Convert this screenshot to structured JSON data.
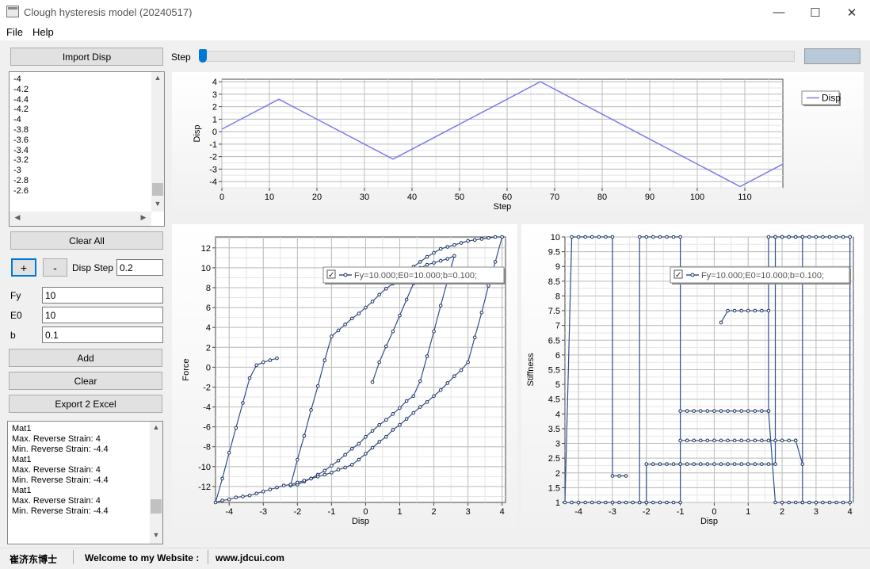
{
  "window": {
    "title": "Clough hysteresis model (20240517)",
    "min": "—",
    "max": "☐",
    "close": "✕"
  },
  "menu": [
    "File",
    "Help"
  ],
  "left": {
    "import_label": "Import Disp",
    "disp_list": [
      "-4",
      "-4.2",
      "-4.4",
      "-4.2",
      "-4",
      "-3.8",
      "-3.6",
      "-3.4",
      "-3.2",
      "-3",
      "-2.8",
      "-2.6"
    ],
    "clear_all_label": "Clear All",
    "plus_label": "+",
    "minus_label": "-",
    "disp_step_label": "Disp Step",
    "disp_step_value": "0.2",
    "fy_label": "Fy",
    "fy_value": "10",
    "e0_label": "E0",
    "e0_value": "10",
    "b_label": "b",
    "b_value": "0.1",
    "add_label": "Add",
    "clear_label": "Clear",
    "export_label": "Export 2 Excel",
    "log_lines": [
      "Mat1",
      "Max. Reverse Strain: 4",
      "Min. Reverse Strain: -4.4",
      "Mat1",
      "Max. Reverse Strain: 4",
      "Min. Reverse Strain: -4.4",
      "Mat1",
      "Max. Reverse Strain: 4",
      "Min. Reverse Strain: -4.4"
    ]
  },
  "step": {
    "label": "Step",
    "position": 0
  },
  "status": {
    "author": "崔济东博士",
    "welcome": "Welcome to my Website :",
    "url": "www.jdcui.com"
  },
  "chart_data": [
    {
      "type": "line",
      "name": "disp-history",
      "xlabel": "Step",
      "ylabel": "Disp",
      "xlim": [
        0,
        118
      ],
      "ylim": [
        -4.5,
        4.2
      ],
      "xticks": [
        0,
        10,
        20,
        30,
        40,
        50,
        60,
        70,
        80,
        90,
        100,
        110
      ],
      "yticks": [
        -4,
        -3,
        -2,
        -1,
        0,
        1,
        2,
        3,
        4
      ],
      "grid": true,
      "legend": "right",
      "series": [
        {
          "name": "Disp",
          "color": "#7b7bea",
          "x": [
            0,
            12,
            36,
            67,
            109,
            118
          ],
          "y": [
            0.2,
            2.6,
            -2.2,
            4,
            -4.4,
            -2.6
          ]
        }
      ]
    },
    {
      "type": "line",
      "name": "force-disp",
      "xlabel": "Disp",
      "ylabel": "Force",
      "xlim": [
        -4.4,
        4.1
      ],
      "ylim": [
        -13.6,
        13.1
      ],
      "xticks": [
        -4,
        -3,
        -2,
        -1,
        0,
        1,
        2,
        3,
        4
      ],
      "yticks": [
        -12,
        -10,
        -8,
        -6,
        -4,
        -2,
        0,
        2,
        4,
        6,
        8,
        10,
        12
      ],
      "grid": true,
      "legend": "top-right",
      "series": [
        {
          "name": "Fy=10.000;E0=10.000;b=0.100;",
          "color": "#2f4f8f",
          "x": [
            0.2,
            0.4,
            0.6,
            0.8,
            1.0,
            1.2,
            1.4,
            1.6,
            1.8,
            2.0,
            2.2,
            2.4,
            2.6,
            2.4,
            2.2,
            2.0,
            1.8,
            1.6,
            1.4,
            1.2,
            1.0,
            0.8,
            0.6,
            0.4,
            0.2,
            0.0,
            -0.2,
            -0.4,
            -0.6,
            -0.8,
            -1.0,
            -1.2,
            -1.4,
            -1.6,
            -1.8,
            -2.0,
            -2.2,
            -2.0,
            -1.8,
            -1.6,
            -1.4,
            -1.2,
            -1.0,
            -0.8,
            -0.6,
            -0.4,
            -0.2,
            0.0,
            0.2,
            0.4,
            0.6,
            0.8,
            1.0,
            1.2,
            1.4,
            1.6,
            1.8,
            2.0,
            2.2,
            2.4,
            2.6,
            2.8,
            3.0,
            3.2,
            3.4,
            3.6,
            3.8,
            4.0,
            3.8,
            3.6,
            3.4,
            3.2,
            3.0,
            2.8,
            2.6,
            2.4,
            2.2,
            2.0,
            1.8,
            1.6,
            1.4,
            1.2,
            1.0,
            0.8,
            0.6,
            0.4,
            0.2,
            0.0,
            -0.2,
            -0.4,
            -0.6,
            -0.8,
            -1.0,
            -1.2,
            -1.4,
            -1.6,
            -1.8,
            -2.0,
            -2.2,
            -2.4,
            -2.6,
            -2.8,
            -3.0,
            -3.2,
            -3.4,
            -3.6,
            -3.8,
            -4.0,
            -4.2,
            -4.4,
            -4.2,
            -4.0,
            -3.8,
            -3.6,
            -3.4,
            -3.2,
            -3.0,
            -2.8,
            -2.6
          ],
          "y": [
            -1.5,
            0.5,
            2.1,
            3.6,
            5.2,
            6.8,
            8.4,
            10.0,
            10.3,
            10.5,
            10.7,
            10.9,
            11.2,
            8.7,
            6.2,
            3.6,
            1.1,
            -1.4,
            -2.9,
            -3.4,
            -4.1,
            -4.7,
            -5.3,
            -5.8,
            -6.4,
            -7.0,
            -7.7,
            -8.2,
            -8.8,
            -9.4,
            -9.9,
            -10.4,
            -10.8,
            -11.2,
            -11.5,
            -11.8,
            -11.9,
            -9.3,
            -6.9,
            -4.3,
            -1.9,
            0.7,
            3.1,
            3.7,
            4.3,
            4.9,
            5.4,
            6.0,
            6.6,
            7.3,
            7.9,
            8.4,
            9.0,
            9.5,
            10.1,
            10.6,
            11.1,
            11.5,
            11.9,
            12.1,
            12.3,
            12.5,
            12.7,
            12.8,
            12.9,
            13.0,
            13.1,
            13.1,
            10.6,
            8.2,
            5.5,
            3.0,
            0.5,
            -0.3,
            -0.9,
            -1.6,
            -2.3,
            -2.9,
            -3.5,
            -4.0,
            -4.6,
            -5.2,
            -5.8,
            -6.3,
            -7.0,
            -7.5,
            -8.1,
            -8.7,
            -9.3,
            -9.8,
            -10.1,
            -10.3,
            -10.6,
            -10.8,
            -11.0,
            -11.2,
            -11.4,
            -11.6,
            -11.8,
            -11.9,
            -12.1,
            -12.3,
            -12.5,
            -12.7,
            -12.9,
            -13.0,
            -13.1,
            -13.3,
            -13.4,
            -13.6,
            -11.2,
            -8.6,
            -6.1,
            -3.6,
            -1.1,
            0.2,
            0.5,
            0.7,
            0.9
          ]
        }
      ]
    },
    {
      "type": "line",
      "name": "stiffness-disp",
      "xlabel": "Disp",
      "ylabel": "Stiffness",
      "xlim": [
        -4.4,
        4.1
      ],
      "ylim": [
        1,
        10
      ],
      "xticks": [
        -4,
        -3,
        -2,
        -1,
        0,
        1,
        2,
        3,
        4
      ],
      "yticks": [
        1,
        1.5,
        2,
        2.5,
        3,
        3.5,
        4,
        4.5,
        5,
        5.5,
        6,
        6.5,
        7,
        7.5,
        8,
        8.5,
        9,
        9.5,
        10
      ],
      "grid": true,
      "legend": "top-right",
      "series": [
        {
          "name": "Fy=10.000;E0=10.000;b=0.100;",
          "color": "#2f4f8f",
          "x": [
            0.2,
            0.4,
            0.6,
            0.8,
            1.0,
            1.2,
            1.4,
            1.6,
            1.6,
            1.8,
            2.0,
            2.2,
            2.4,
            2.6,
            2.6,
            2.4,
            2.4,
            2.2,
            2.0,
            1.8,
            1.6,
            1.4,
            1.2,
            1.0,
            0.8,
            0.6,
            0.4,
            0.2,
            0.0,
            -0.2,
            -0.4,
            -0.6,
            -0.8,
            -1.0,
            -1.0,
            -1.2,
            -1.4,
            -1.6,
            -1.8,
            -2.0,
            -2.2,
            -2.2,
            -2.0,
            -2.0,
            -1.8,
            -1.6,
            -1.4,
            -1.2,
            -1.0,
            -1.0,
            -0.8,
            -0.6,
            -0.4,
            -0.2,
            0.0,
            0.2,
            0.4,
            0.6,
            0.8,
            1.0,
            1.2,
            1.4,
            1.6,
            1.6,
            1.8,
            2.0,
            2.2,
            2.4,
            2.6,
            2.8,
            3.0,
            3.2,
            3.4,
            3.6,
            3.8,
            4.0,
            4.0,
            3.8,
            3.6,
            3.4,
            3.2,
            3.0,
            2.8,
            2.6,
            2.6,
            2.4,
            2.2,
            2.0,
            1.8,
            1.8,
            1.6,
            1.4,
            1.2,
            1.0,
            0.8,
            0.6,
            0.4,
            0.2,
            0.0,
            -0.2,
            -0.4,
            -0.6,
            -0.8,
            -1.0,
            -1.0,
            -1.2,
            -1.4,
            -1.6,
            -1.8,
            -2.0,
            -2.2,
            -2.4,
            -2.6,
            -2.8,
            -3.0,
            -3.2,
            -3.4,
            -3.6,
            -3.8,
            -4.0,
            -4.2,
            -4.4,
            -4.2,
            -4.0,
            -3.8,
            -3.6,
            -3.4,
            -3.2,
            -3.0,
            -3.0,
            -2.8,
            -2.6
          ],
          "y": [
            7.1,
            7.5,
            7.5,
            7.5,
            7.5,
            7.5,
            7.5,
            7.5,
            4.1,
            1,
            1,
            1,
            1,
            1,
            2.3,
            3.1,
            3.1,
            3.1,
            3.1,
            3.1,
            3.1,
            3.1,
            3.1,
            3.1,
            3.1,
            3.1,
            3.1,
            3.1,
            3.1,
            3.1,
            3.1,
            3.1,
            3.1,
            3.1,
            10,
            10,
            10,
            10,
            10,
            10,
            10,
            1,
            1,
            2.3,
            2.3,
            2.3,
            2.3,
            2.3,
            2.3,
            4.1,
            4.1,
            4.1,
            4.1,
            4.1,
            4.1,
            4.1,
            4.1,
            4.1,
            4.1,
            4.1,
            4.1,
            4.1,
            4.1,
            10,
            10,
            10,
            10,
            10,
            10,
            10,
            10,
            10,
            10,
            10,
            10,
            10,
            1,
            1,
            1,
            1,
            1,
            1,
            1,
            1,
            10,
            10,
            10,
            10,
            10,
            2.3,
            2.3,
            2.3,
            2.3,
            2.3,
            2.3,
            2.3,
            2.3,
            2.3,
            2.3,
            2.3,
            2.3,
            2.3,
            2.3,
            2.3,
            1,
            1,
            1,
            1,
            1,
            1,
            1,
            1,
            1,
            1,
            1,
            1,
            1,
            1,
            1,
            1,
            1,
            1,
            10,
            10,
            10,
            10,
            10,
            10,
            10,
            1.9,
            1.9,
            1.9
          ]
        }
      ]
    }
  ]
}
